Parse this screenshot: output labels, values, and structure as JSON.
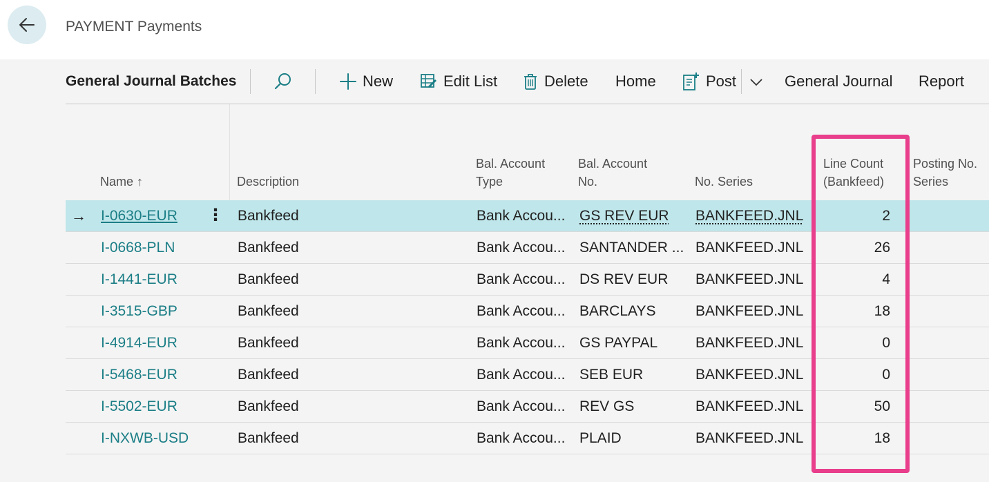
{
  "header": {
    "title": "PAYMENT Payments"
  },
  "actionbar": {
    "title": "General Journal Batches",
    "new_label": "New",
    "edit_list_label": "Edit List",
    "delete_label": "Delete",
    "home_label": "Home",
    "post_label": "Post",
    "general_journal_label": "General Journal",
    "report_label": "Report"
  },
  "columns": {
    "name": "Name ↑",
    "description": "Description",
    "bal_type_1": "Bal. Account",
    "bal_type_2": "Type",
    "bal_no_1": "Bal. Account",
    "bal_no_2": "No.",
    "no_series": "No. Series",
    "line_count_1": "Line Count",
    "line_count_2": "(Bankfeed)",
    "posting_1": "Posting No.",
    "posting_2": "Series"
  },
  "rows": [
    {
      "name": "I-0630-EUR",
      "description": "Bankfeed",
      "bal_type": "Bank Accou...",
      "bal_no": "GS REV EUR",
      "no_series": "BANKFEED.JNL",
      "line_count": "2"
    },
    {
      "name": "I-0668-PLN",
      "description": "Bankfeed",
      "bal_type": "Bank Accou...",
      "bal_no": "SANTANDER ...",
      "no_series": "BANKFEED.JNL",
      "line_count": "26"
    },
    {
      "name": "I-1441-EUR",
      "description": "Bankfeed",
      "bal_type": "Bank Accou...",
      "bal_no": "DS REV EUR",
      "no_series": "BANKFEED.JNL",
      "line_count": "4"
    },
    {
      "name": "I-3515-GBP",
      "description": "Bankfeed",
      "bal_type": "Bank Accou...",
      "bal_no": "BARCLAYS",
      "no_series": "BANKFEED.JNL",
      "line_count": "18"
    },
    {
      "name": "I-4914-EUR",
      "description": "Bankfeed",
      "bal_type": "Bank Accou...",
      "bal_no": "GS PAYPAL",
      "no_series": "BANKFEED.JNL",
      "line_count": "0"
    },
    {
      "name": "I-5468-EUR",
      "description": "Bankfeed",
      "bal_type": "Bank Accou...",
      "bal_no": "SEB EUR",
      "no_series": "BANKFEED.JNL",
      "line_count": "0"
    },
    {
      "name": "I-5502-EUR",
      "description": "Bankfeed",
      "bal_type": "Bank Accou...",
      "bal_no": "REV GS",
      "no_series": "BANKFEED.JNL",
      "line_count": "50"
    },
    {
      "name": "I-NXWB-USD",
      "description": "Bankfeed",
      "bal_type": "Bank Accou...",
      "bal_no": "PLAID",
      "no_series": "BANKFEED.JNL",
      "line_count": "18"
    }
  ],
  "colors": {
    "accent_link": "#1b7e86",
    "selected_row": "#bfe6ea",
    "highlight_box": "#e83e8c",
    "back_button": "#dcecf0"
  },
  "icons": {
    "back": "arrow-left-icon",
    "search": "search-icon",
    "new": "plus-icon",
    "edit_list": "edit-list-icon",
    "delete": "trash-icon",
    "post": "post-icon",
    "more": "chevron-down-icon",
    "row_current": "arrow-right-icon",
    "row_menu": "vertical-ellipsis-icon"
  }
}
